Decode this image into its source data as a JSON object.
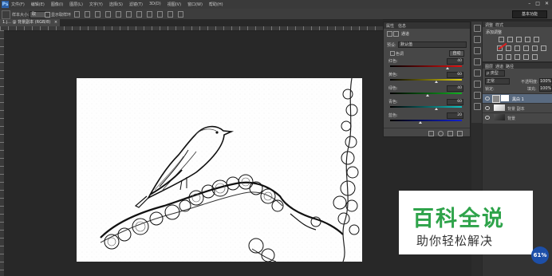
{
  "app": {
    "logo": "Ps"
  },
  "menubar": {
    "items": [
      "文件(F)",
      "编辑(E)",
      "图像(I)",
      "图层(L)",
      "文字(Y)",
      "选择(S)",
      "滤镜(T)",
      "3D(D)",
      "视图(V)",
      "窗口(W)",
      "帮助(H)"
    ],
    "window_buttons": [
      "–",
      "□",
      "✕"
    ]
  },
  "options_bar": {
    "sample_label": "样本大小:",
    "sample_value": "取",
    "checkbox_label": "显示取样环",
    "workspace": "基本功能"
  },
  "document_tab": {
    "label": "1.j... @ 背景副本 (RGB/8)",
    "close": "×"
  },
  "properties_panel": {
    "tabs": [
      "属性",
      "信息"
    ],
    "title": "通道",
    "preset_label": "预设:",
    "preset_value": "默认值",
    "mode_label": "色调",
    "auto_button": "自动",
    "sliders": [
      {
        "label": "红色:",
        "value": "40",
        "pos": 0.78
      },
      {
        "label": "黄色:",
        "value": "60",
        "pos": 0.62
      },
      {
        "label": "绿色:",
        "value": "40",
        "pos": 0.5
      },
      {
        "label": "青色:",
        "value": "60",
        "pos": 0.62
      },
      {
        "label": "蓝色:",
        "value": "20",
        "pos": 0.4
      }
    ]
  },
  "adjustments_panel": {
    "tabs": [
      "调整",
      "样式"
    ],
    "title": "添加调整"
  },
  "layers_panel": {
    "tabs": [
      "图层",
      "通道",
      "路径"
    ],
    "filter_label": "ρ 类型",
    "blend_mode": "正常",
    "opacity_label": "不透明度:",
    "opacity_value": "100%",
    "lock_label": "锁定:",
    "fill_label": "填充:",
    "fill_value": "100%",
    "layers": [
      {
        "name": "黑白 1",
        "selected": true
      },
      {
        "name": "背景 副本",
        "selected": false
      },
      {
        "name": "背景",
        "selected": false
      }
    ]
  },
  "watermark": {
    "title": "百科全说",
    "subtitle": "助你轻松解决"
  },
  "badge": {
    "text": "61%"
  }
}
